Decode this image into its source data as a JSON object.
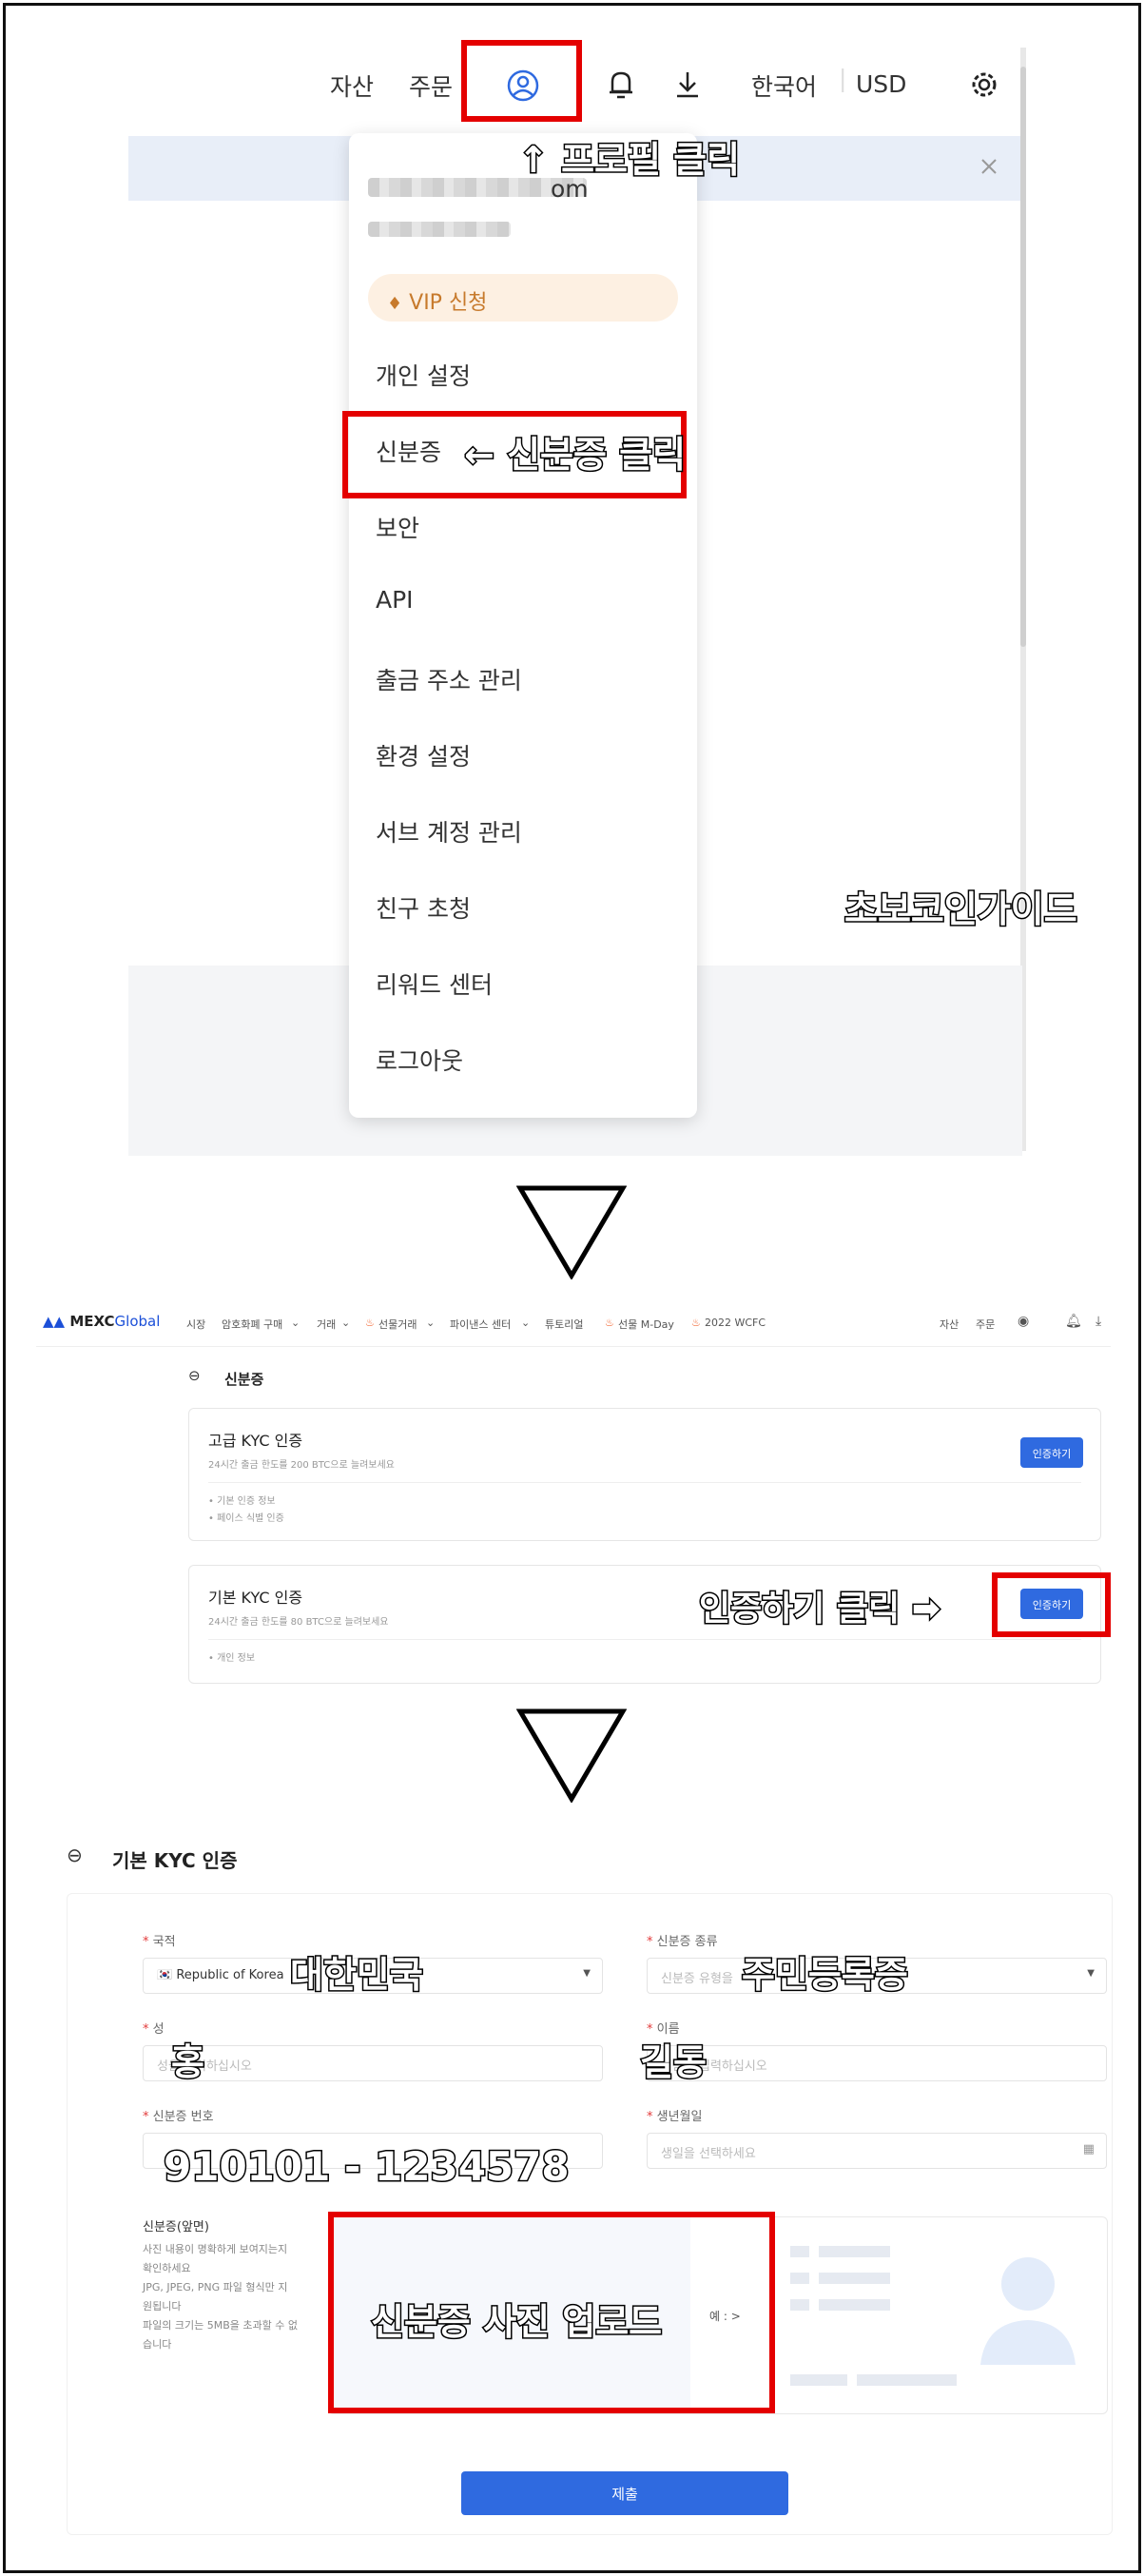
{
  "screen1": {
    "nav": {
      "assets": "자산",
      "orders": "주문",
      "language": "한국어",
      "currency": "USD"
    },
    "email_suffix": "om",
    "vip_label": "VIP 신청",
    "menu_items": [
      "개인 설정",
      "신분증",
      "보안",
      "API",
      "출금 주소 관리",
      "환경 설정",
      "서브 계정 관리",
      "친구 초청",
      "리워드 센터",
      "로그아웃"
    ]
  },
  "annotations": {
    "profile_click": "↑ 프로필 클릭",
    "id_click": "← 신분증 클릭",
    "watermark": "초보코인가이드",
    "verify_click": "인증하기 클릭 ➡",
    "country": "대한민국",
    "id_type": "주민등록증",
    "last_name": "홍",
    "first_name": "길동",
    "id_number": "910101 - 1234578",
    "upload": "신분증 사진 업로드"
  },
  "screen2": {
    "logo_text": "MEXC",
    "logo_suffix": "Global",
    "nav_items": [
      "시장",
      "암호화폐 구매",
      "거래",
      "선물거래",
      "파이낸스 센터",
      "튜토리얼",
      "선물 M-Day",
      "2022 WCFC"
    ],
    "nav_right": [
      "자산",
      "주문"
    ],
    "page_title": "신분증",
    "advanced": {
      "title": "고급 KYC 인증",
      "subtitle": "24시간 출금 한도를 200 BTC으로 늘려보세요",
      "items": [
        "• 기본 인증 정보",
        "• 페이스 식별 인증"
      ],
      "button": "인증하기"
    },
    "basic": {
      "title": "기본 KYC 인증",
      "subtitle": "24시간 출금 한도를 80 BTC으로 늘려보세요",
      "items": [
        "• 개인 정보"
      ],
      "button": "인증하기"
    }
  },
  "screen3": {
    "title": "기본 KYC 인증",
    "country_label": "국적",
    "country_value": "Republic of Korea",
    "id_type_label": "신분증 종류",
    "id_type_placeholder": "신분증 유형을",
    "last_name_label": "성",
    "last_name_placeholder": "성을 입력하십시오",
    "first_name_label": "이름",
    "first_name_placeholder": "이름을 입력하십시오",
    "id_number_label": "신분증 번호",
    "birth_label": "생년월일",
    "birth_placeholder": "생일을 선택하세요",
    "upload_label": "신분증(앞면)",
    "upload_notes": [
      "사진 내용이 명확하게 보여지는지",
      "확인하세요",
      "JPG, JPEG, PNG 파일 형식만 지",
      "원됩니다",
      "파일의 크기는 5MB을 초과할 수 없",
      "습니다"
    ],
    "example_label": "예 : >",
    "submit": "제출"
  }
}
